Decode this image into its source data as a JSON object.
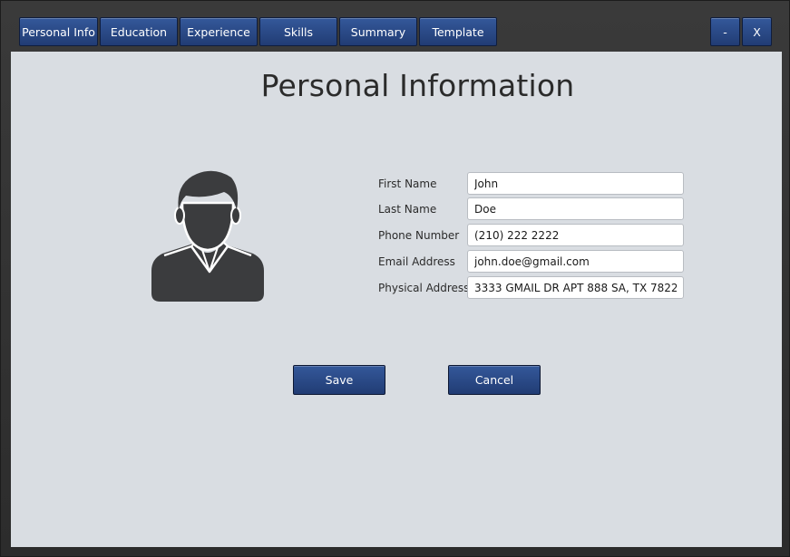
{
  "tabs": [
    {
      "label": "Personal Info"
    },
    {
      "label": "Education"
    },
    {
      "label": "Experience"
    },
    {
      "label": "Skills"
    },
    {
      "label": "Summary"
    },
    {
      "label": "Template"
    }
  ],
  "window_controls": {
    "minimize_label": "-",
    "close_label": "X"
  },
  "page": {
    "title": "Personal Information"
  },
  "avatar": {
    "icon": "user-avatar-icon",
    "color": "#3b3c3e"
  },
  "form": {
    "first_name": {
      "label": "First Name",
      "value": "John"
    },
    "last_name": {
      "label": "Last Name",
      "value": "Doe"
    },
    "phone": {
      "label": "Phone Number",
      "value": "(210) 222 2222"
    },
    "email": {
      "label": "Email Address",
      "value": "john.doe@gmail.com"
    },
    "address": {
      "label": "Physical Address",
      "value": "3333 GMAIL DR APT 888 SA, TX 78222"
    }
  },
  "actions": {
    "save_label": "Save",
    "cancel_label": "Cancel"
  },
  "colors": {
    "accent": "#2a4a88",
    "content_bg": "#d9dde2",
    "frame": "#2e2e2e"
  }
}
